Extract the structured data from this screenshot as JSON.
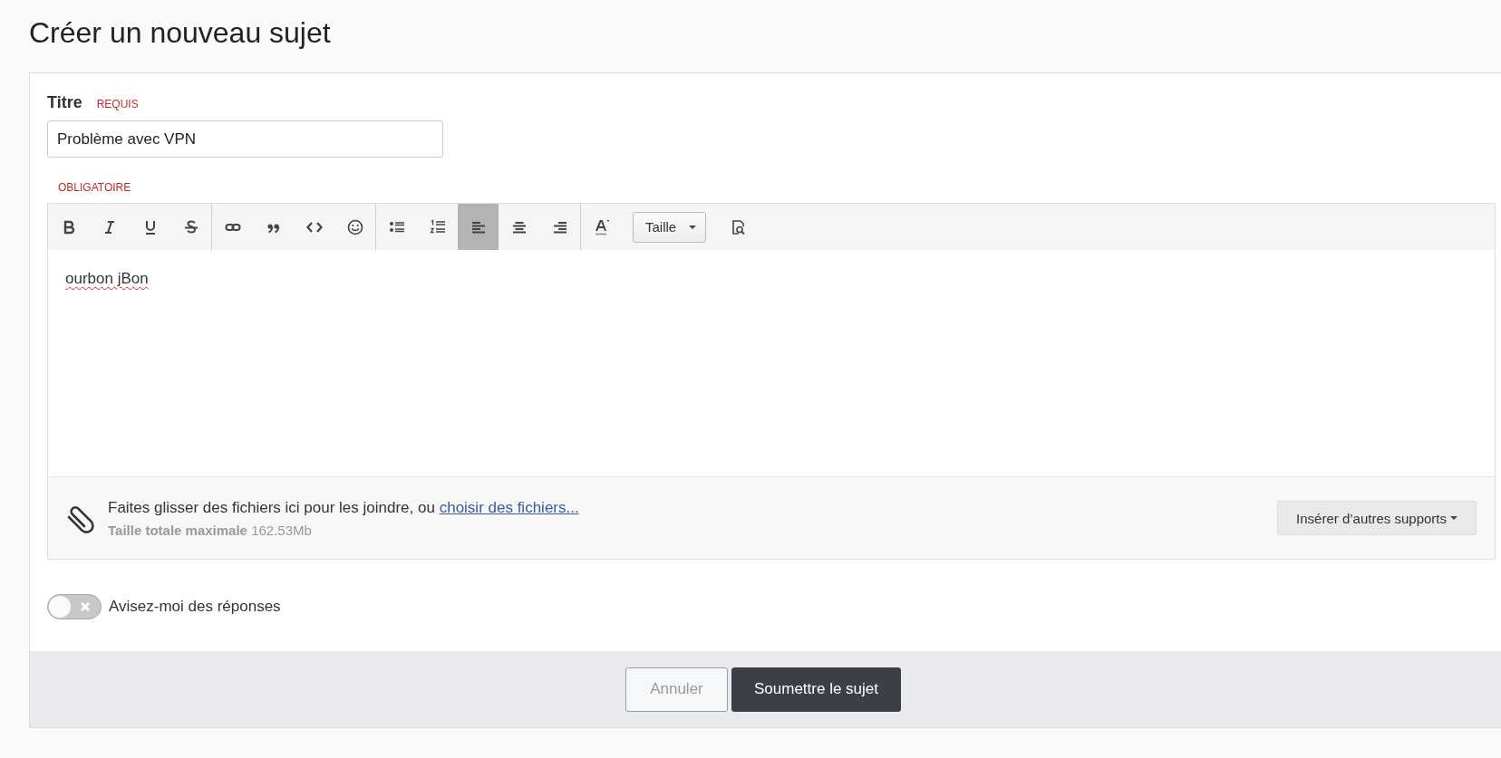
{
  "page_title": "Créer un nouveau sujet",
  "title_field": {
    "label": "Titre",
    "required_note": "REQUIS",
    "value": "Problème avec VPN"
  },
  "editor": {
    "required_note": "OBLIGATOIRE",
    "toolbar": [
      [
        {
          "kind": "bold",
          "selected": false
        },
        {
          "kind": "italic",
          "selected": false
        },
        {
          "kind": "underline",
          "selected": false
        },
        {
          "kind": "strike",
          "selected": false
        }
      ],
      [
        {
          "kind": "link",
          "selected": false
        },
        {
          "kind": "quote",
          "selected": false
        },
        {
          "kind": "code",
          "selected": false
        },
        {
          "kind": "emoji",
          "selected": false
        }
      ],
      [
        {
          "kind": "bullets",
          "selected": false
        },
        {
          "kind": "numbers",
          "selected": false
        },
        {
          "kind": "align-left",
          "selected": true
        },
        {
          "kind": "align-center",
          "selected": false
        },
        {
          "kind": "align-right",
          "selected": false
        }
      ],
      [
        {
          "kind": "text-color",
          "selected": false
        },
        {
          "kind": "dropdown",
          "label": "Taille"
        },
        {
          "kind": "preview",
          "selected": false
        }
      ]
    ],
    "content": {
      "text": "ourbon jBon",
      "misspelled": true
    }
  },
  "attachments": {
    "hint": "Faites glisser des fichiers ici pour les joindre, ou",
    "link": "choisir des fichiers...",
    "size_label": "Taille totale maximale",
    "size_value": "162.53Mb",
    "media_button": "Insérer d’autres supports"
  },
  "notify": {
    "label": "Avisez-moi des réponses",
    "on": false
  },
  "buttons": [
    {
      "label": "Annuler",
      "kind": "secondary"
    },
    {
      "label": "Soumettre le sujet",
      "kind": "primary"
    }
  ]
}
